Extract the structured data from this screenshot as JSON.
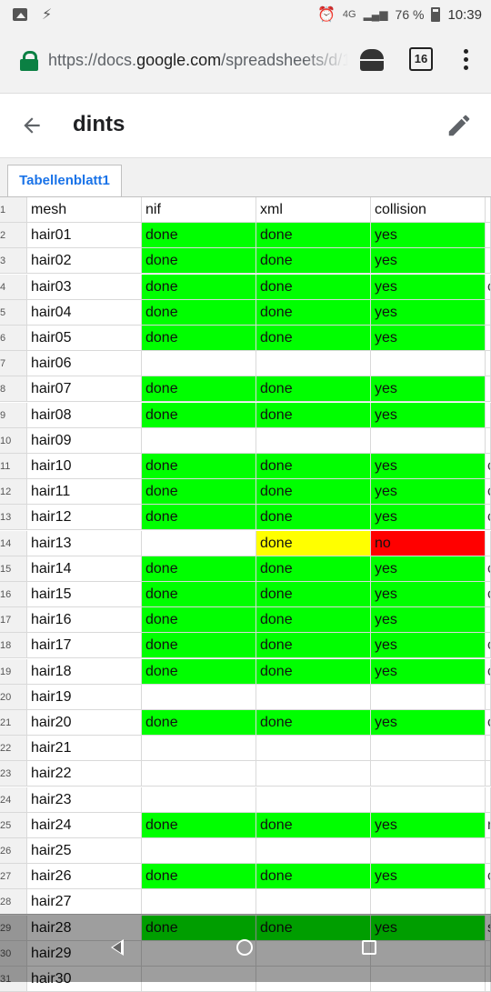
{
  "status_bar": {
    "network": "4G",
    "battery": "76 %",
    "time": "10:39",
    "icons": [
      "image-icon",
      "flash-icon",
      "alarm-icon",
      "signal-icon",
      "battery-icon"
    ]
  },
  "browser": {
    "url_prefix": "https://docs.",
    "url_host": "google.com",
    "url_path": "/spreadsheets/d/1",
    "tab_count": "16",
    "secure_color": "#0b8043"
  },
  "app_bar": {
    "title": "dints"
  },
  "sheet_tabs": [
    "Tabellenblatt1"
  ],
  "colors": {
    "done_green": "#00ff00",
    "warning_yellow": "#ffff00",
    "error_red": "#ff0000",
    "accent_blue": "#1a73e8"
  },
  "table": {
    "headers": [
      "mesh",
      "nif",
      "xml",
      "collision"
    ],
    "header_row_number": "1",
    "rows": [
      {
        "n": "2",
        "cells": [
          "hair01",
          "done",
          "done",
          "yes"
        ],
        "colors": [
          "",
          "g",
          "g",
          "g"
        ],
        "extra": ""
      },
      {
        "n": "3",
        "cells": [
          "hair02",
          "done",
          "done",
          "yes"
        ],
        "colors": [
          "",
          "g",
          "g",
          "g"
        ],
        "extra": ""
      },
      {
        "n": "4",
        "cells": [
          "hair03",
          "done",
          "done",
          "yes"
        ],
        "colors": [
          "",
          "g",
          "g",
          "g"
        ],
        "extra": "c"
      },
      {
        "n": "5",
        "cells": [
          "hair04",
          "done",
          "done",
          "yes"
        ],
        "colors": [
          "",
          "g",
          "g",
          "g"
        ],
        "extra": ""
      },
      {
        "n": "6",
        "cells": [
          "hair05",
          "done",
          "done",
          "yes"
        ],
        "colors": [
          "",
          "g",
          "g",
          "g"
        ],
        "extra": ""
      },
      {
        "n": "7",
        "cells": [
          "hair06",
          "",
          "",
          ""
        ],
        "colors": [
          "",
          "",
          "",
          ""
        ],
        "extra": ""
      },
      {
        "n": "8",
        "cells": [
          "hair07",
          "done",
          "done",
          "yes"
        ],
        "colors": [
          "",
          "g",
          "g",
          "g"
        ],
        "extra": ""
      },
      {
        "n": "9",
        "cells": [
          "hair08",
          "done",
          "done",
          "yes"
        ],
        "colors": [
          "",
          "g",
          "g",
          "g"
        ],
        "extra": ""
      },
      {
        "n": "10",
        "cells": [
          "hair09",
          "",
          "",
          ""
        ],
        "colors": [
          "",
          "",
          "",
          ""
        ],
        "extra": ""
      },
      {
        "n": "11",
        "cells": [
          "hair10",
          "done",
          "done",
          "yes"
        ],
        "colors": [
          "",
          "g",
          "g",
          "g"
        ],
        "extra": "c"
      },
      {
        "n": "12",
        "cells": [
          "hair11",
          "done",
          "done",
          "yes"
        ],
        "colors": [
          "",
          "g",
          "g",
          "g"
        ],
        "extra": "c"
      },
      {
        "n": "13",
        "cells": [
          "hair12",
          "done",
          "done",
          "yes"
        ],
        "colors": [
          "",
          "g",
          "g",
          "g"
        ],
        "extra": "c"
      },
      {
        "n": "14",
        "cells": [
          "hair13",
          "",
          "done",
          "no"
        ],
        "colors": [
          "",
          "",
          "y",
          "r"
        ],
        "extra": ""
      },
      {
        "n": "15",
        "cells": [
          "hair14",
          "done",
          "done",
          "yes"
        ],
        "colors": [
          "",
          "g",
          "g",
          "g"
        ],
        "extra": "c"
      },
      {
        "n": "16",
        "cells": [
          "hair15",
          "done",
          "done",
          "yes"
        ],
        "colors": [
          "",
          "g",
          "g",
          "g"
        ],
        "extra": "c"
      },
      {
        "n": "17",
        "cells": [
          "hair16",
          "done",
          "done",
          "yes"
        ],
        "colors": [
          "",
          "g",
          "g",
          "g"
        ],
        "extra": ""
      },
      {
        "n": "18",
        "cells": [
          "hair17",
          "done",
          "done",
          "yes"
        ],
        "colors": [
          "",
          "g",
          "g",
          "g"
        ],
        "extra": "c"
      },
      {
        "n": "19",
        "cells": [
          "hair18",
          "done",
          "done",
          "yes"
        ],
        "colors": [
          "",
          "g",
          "g",
          "g"
        ],
        "extra": "c"
      },
      {
        "n": "20",
        "cells": [
          "hair19",
          "",
          "",
          ""
        ],
        "colors": [
          "",
          "",
          "",
          ""
        ],
        "extra": ""
      },
      {
        "n": "21",
        "cells": [
          "hair20",
          "done",
          "done",
          "yes"
        ],
        "colors": [
          "",
          "g",
          "g",
          "g"
        ],
        "extra": "c"
      },
      {
        "n": "22",
        "cells": [
          "hair21",
          "",
          "",
          ""
        ],
        "colors": [
          "",
          "",
          "",
          ""
        ],
        "extra": ""
      },
      {
        "n": "23",
        "cells": [
          "hair22",
          "",
          "",
          ""
        ],
        "colors": [
          "",
          "",
          "",
          ""
        ],
        "extra": ""
      },
      {
        "n": "24",
        "cells": [
          "hair23",
          "",
          "",
          ""
        ],
        "colors": [
          "",
          "",
          "",
          ""
        ],
        "extra": ""
      },
      {
        "n": "25",
        "cells": [
          "hair24",
          "done",
          "done",
          "yes"
        ],
        "colors": [
          "",
          "g",
          "g",
          "g"
        ],
        "extra": "r"
      },
      {
        "n": "26",
        "cells": [
          "hair25",
          "",
          "",
          ""
        ],
        "colors": [
          "",
          "",
          "",
          ""
        ],
        "extra": ""
      },
      {
        "n": "27",
        "cells": [
          "hair26",
          "done",
          "done",
          "yes"
        ],
        "colors": [
          "",
          "g",
          "g",
          "g"
        ],
        "extra": "c"
      },
      {
        "n": "28",
        "cells": [
          "hair27",
          "",
          "",
          ""
        ],
        "colors": [
          "",
          "",
          "",
          ""
        ],
        "extra": ""
      },
      {
        "n": "29",
        "cells": [
          "hair28",
          "done",
          "done",
          "yes"
        ],
        "colors": [
          "",
          "g",
          "g",
          "g"
        ],
        "extra": "s"
      },
      {
        "n": "30",
        "cells": [
          "hair29",
          "",
          "",
          ""
        ],
        "colors": [
          "",
          "",
          "",
          ""
        ],
        "extra": ""
      },
      {
        "n": "31",
        "cells": [
          "hair30",
          "",
          "",
          ""
        ],
        "colors": [
          "",
          "",
          "",
          ""
        ],
        "extra": ""
      }
    ]
  },
  "nav_bar": {
    "buttons": [
      "back-nav",
      "home-nav",
      "recents-nav"
    ]
  }
}
